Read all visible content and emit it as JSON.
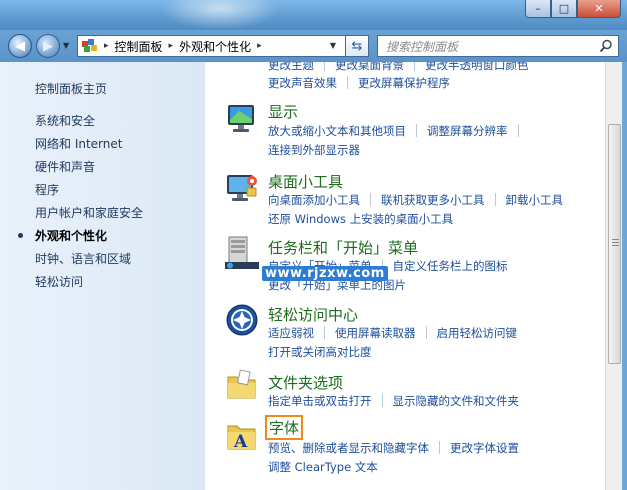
{
  "window": {
    "minimize": "–",
    "maximize": "□",
    "close": "✕"
  },
  "nav": {
    "back_icon": "arrow-left-icon",
    "forward_icon": "arrow-right-icon",
    "breadcrumbs": [
      "控制面板",
      "外观和个性化"
    ],
    "search_placeholder": "搜索控制面板"
  },
  "sidebar": {
    "home": "控制面板主页",
    "items": [
      {
        "label": "系统和安全",
        "active": false
      },
      {
        "label": "网络和 Internet",
        "active": false
      },
      {
        "label": "硬件和声音",
        "active": false
      },
      {
        "label": "程序",
        "active": false
      },
      {
        "label": "用户帐户和家庭安全",
        "active": false
      },
      {
        "label": "外观和个性化",
        "active": true
      },
      {
        "label": "时钟、语言和区域",
        "active": false
      },
      {
        "label": "轻松访问",
        "active": false
      }
    ]
  },
  "main": {
    "top_partial": {
      "row1": [
        "更改主题",
        "更改桌面背景",
        "更改半透明窗口颜色"
      ],
      "row2": [
        "更改声音效果",
        "更改屏幕保护程序"
      ]
    },
    "sections": [
      {
        "title": "显示",
        "icon": "display-icon",
        "rows": [
          [
            "放大或缩小文本和其他项目",
            "调整屏幕分辨率"
          ],
          [
            "连接到外部显示器"
          ]
        ]
      },
      {
        "title": "桌面小工具",
        "icon": "gadgets-icon",
        "rows": [
          [
            "向桌面添加小工具",
            "联机获取更多小工具",
            "卸载小工具"
          ],
          [
            "还原 Windows 上安装的桌面小工具"
          ]
        ]
      },
      {
        "title": "任务栏和「开始」菜单",
        "icon": "taskbar-icon",
        "rows": [
          [
            "自定义「开始」菜单",
            "自定义任务栏上的图标"
          ],
          [
            "更改「开始」菜单上的图片"
          ]
        ]
      },
      {
        "title": "轻松访问中心",
        "icon": "ease-of-access-icon",
        "rows": [
          [
            "适应弱视",
            "使用屏幕读取器",
            "启用轻松访问键"
          ],
          [
            "打开或关闭高对比度"
          ]
        ]
      },
      {
        "title": "文件夹选项",
        "icon": "folder-options-icon",
        "rows": [
          [
            "指定单击或双击打开",
            "显示隐藏的文件和文件夹"
          ]
        ]
      },
      {
        "title": "字体",
        "icon": "fonts-icon",
        "rows": [
          [
            "预览、删除或者显示和隐藏字体",
            "更改字体设置"
          ],
          [
            "调整 ClearType 文本"
          ]
        ]
      }
    ]
  },
  "watermark": "www.rjzxw.com",
  "colors": {
    "link": "#1e4e9c",
    "section_title": "#1b6c1b",
    "highlight_box": "#f08a1c",
    "sidebar_bg": "#e3edf9"
  }
}
